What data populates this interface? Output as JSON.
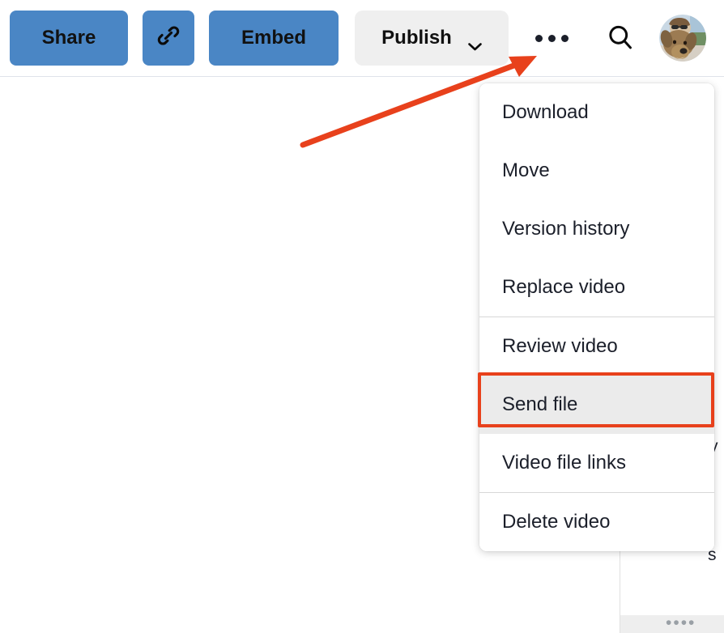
{
  "header": {
    "share_label": "Share",
    "copy_link_icon": "link-icon",
    "embed_label": "Embed",
    "publish_label": "Publish",
    "publish_chevron_icon": "chevron-down-icon",
    "more_icon": "more-horizontal-icon",
    "search_icon": "search-icon",
    "avatar_icon": "user-avatar-dog-photo"
  },
  "colors": {
    "button_blue": "#4a86c5",
    "button_gray": "#efefef",
    "annotation_red": "#e8411c",
    "menu_highlight_gray": "#ebebeb",
    "text_dark": "#1b1f2a",
    "divider": "#d8d8d8"
  },
  "more_menu": {
    "groups": [
      {
        "items": [
          {
            "label": "Download",
            "highlighted": false
          },
          {
            "label": "Move",
            "highlighted": false
          },
          {
            "label": "Version history",
            "highlighted": false
          },
          {
            "label": "Replace video",
            "highlighted": false
          }
        ]
      },
      {
        "items": [
          {
            "label": "Review video",
            "highlighted": false
          },
          {
            "label": "Send file",
            "highlighted": true
          },
          {
            "label": "Video file links",
            "highlighted": false
          }
        ]
      },
      {
        "items": [
          {
            "label": "Delete video",
            "highlighted": false
          }
        ]
      }
    ]
  },
  "background": {
    "partial_text_1": "y",
    "partial_text_2": "s",
    "partial_ellipsis": "••••"
  },
  "annotations": {
    "arrow_target": "more-horizontal-button",
    "highlight_target": "Send file"
  }
}
